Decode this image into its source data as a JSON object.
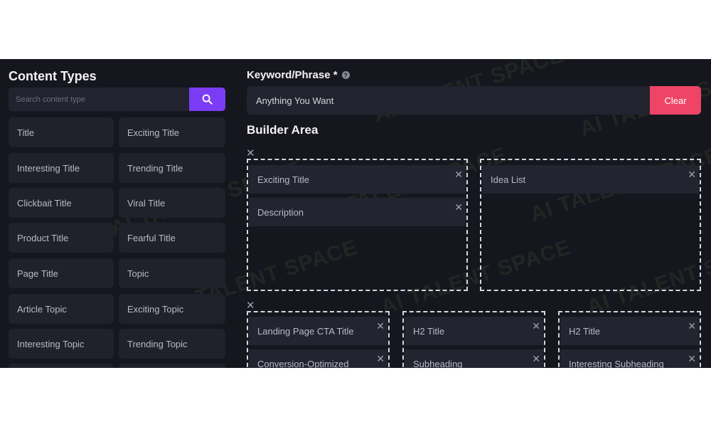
{
  "sidebar": {
    "title": "Content Types",
    "search_placeholder": "Search content type",
    "items": [
      "Title",
      "Exciting Title",
      "Interesting Title",
      "Trending Title",
      "Clickbait Title",
      "Viral Title",
      "Product Title",
      "Fearful Title",
      "Page Title",
      "Topic",
      "Article Topic",
      "Exciting Topic",
      "Interesting Topic",
      "Trending Topic"
    ]
  },
  "keyword": {
    "label": "Keyword/Phrase *",
    "value": "Anything You Want",
    "clear_label": "Clear"
  },
  "builder": {
    "title": "Builder Area",
    "row1": {
      "zone1": [
        "Exciting Title",
        "Description"
      ],
      "zone2": [
        "Idea List"
      ]
    },
    "row2": {
      "zone1": [
        "Landing Page CTA Title",
        "Conversion-Optimized"
      ],
      "zone2": [
        "H2 Title",
        "Subheading"
      ],
      "zone3": [
        "H2 Title",
        "Interesting Subheading"
      ]
    }
  },
  "watermark": "AI TALENT SPACE",
  "icons": {
    "search": "search-icon",
    "close": "close-icon",
    "help": "help-icon"
  },
  "colors": {
    "background": "#16161f",
    "search_button": "#7b3cf5",
    "clear_button": "#ef4466"
  }
}
